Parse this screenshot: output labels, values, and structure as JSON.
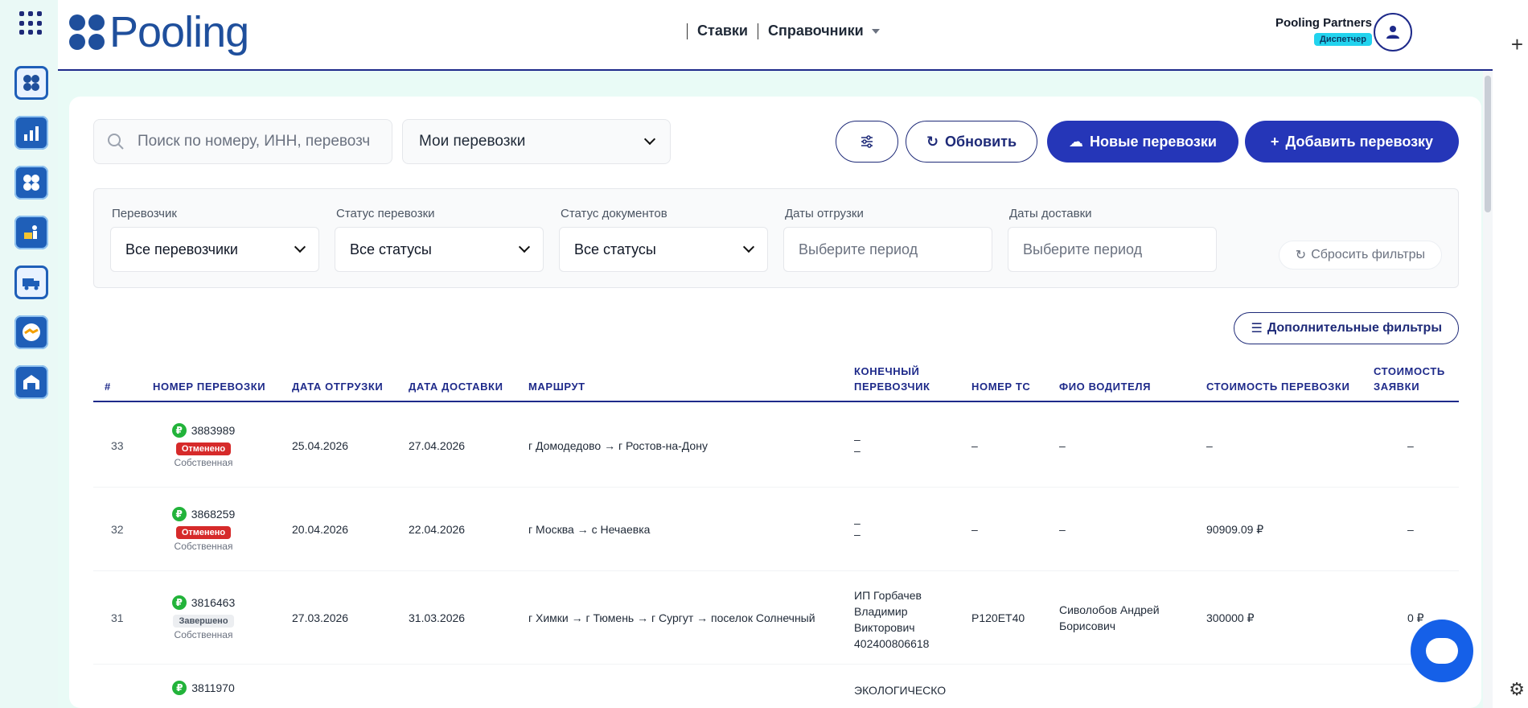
{
  "app": {
    "logo_text": "Pooling"
  },
  "nav": {
    "rates": "Ставки",
    "directories": "Справочники"
  },
  "user": {
    "name": "Pooling Partners",
    "role": "Диспетчер"
  },
  "toolbar": {
    "search_placeholder": "Поиск по номеру, ИНН, перевозч",
    "my_select": "Мои перевозки",
    "refresh": "Обновить",
    "new_trips": "Новые перевозки",
    "add_trip": "Добавить перевозку"
  },
  "filters": {
    "carrier_label": "Перевозчик",
    "carrier_value": "Все перевозчики",
    "trip_status_label": "Статус перевозки",
    "trip_status_value": "Все статусы",
    "doc_status_label": "Статус документов",
    "doc_status_value": "Все статусы",
    "ship_dates_label": "Даты отгрузки",
    "ship_dates_placeholder": "Выберите период",
    "delivery_dates_label": "Даты доставки",
    "delivery_dates_placeholder": "Выберите период",
    "reset": "Сбросить фильтры",
    "more": "Дополнительные фильтры"
  },
  "table": {
    "headers": {
      "index": "#",
      "trip_no": "НОМЕР ПЕРЕВОЗКИ",
      "ship_date": "ДАТА ОТГРУЗКИ",
      "delivery_date": "ДАТА ДОСТАВКИ",
      "route": "МАРШРУТ",
      "carrier_1": "КОНЕЧНЫЙ",
      "carrier_2": "ПЕРЕВОЗЧИК",
      "vehicle": "НОМЕР ТС",
      "driver": "ФИО ВОДИТЕЛЯ",
      "trip_cost": "СТОИМОСТЬ ПЕРЕВОЗКИ",
      "order_cost_1": "СТОИМОСТЬ",
      "order_cost_2": "ЗАЯВКИ"
    },
    "rows": [
      {
        "index": "33",
        "trip_no": "3883989",
        "status": "Отменено",
        "ownership": "Собственная",
        "ship_date": "25.04.2026",
        "delivery_date": "27.04.2026",
        "route": "г Домодедово → г Ростов-на-Дону",
        "carrier_line1": "–",
        "carrier_line2": "–",
        "vehicle": "–",
        "driver": "–",
        "trip_cost": "–",
        "order_cost": "–"
      },
      {
        "index": "32",
        "trip_no": "3868259",
        "status": "Отменено",
        "ownership": "Собственная",
        "ship_date": "20.04.2026",
        "delivery_date": "22.04.2026",
        "route": "г Москва → с Нечаевка",
        "carrier_line1": "–",
        "carrier_line2": "–",
        "vehicle": "–",
        "driver": "–",
        "trip_cost": "90909.09 ₽",
        "order_cost": "–"
      },
      {
        "index": "31",
        "trip_no": "3816463",
        "status": "Завершено",
        "ownership": "Собственная",
        "ship_date": "27.03.2026",
        "delivery_date": "31.03.2026",
        "route": "г Химки → г Тюмень → г Сургут → поселок Солнечный",
        "carrier_line1": "ИП Горбачев",
        "carrier_line2": "Владимир",
        "carrier_line3": "Викторович",
        "carrier_inn": "402400806618",
        "vehicle": "Р120ЕТ40",
        "driver_line1": "Сиволобов Андрей",
        "driver_line2": "Борисович",
        "trip_cost": "300000 ₽",
        "order_cost": "0 ₽"
      },
      {
        "trip_no": "3811970",
        "carrier_line1": "ЭКОЛОГИЧЕСКО"
      }
    ]
  }
}
